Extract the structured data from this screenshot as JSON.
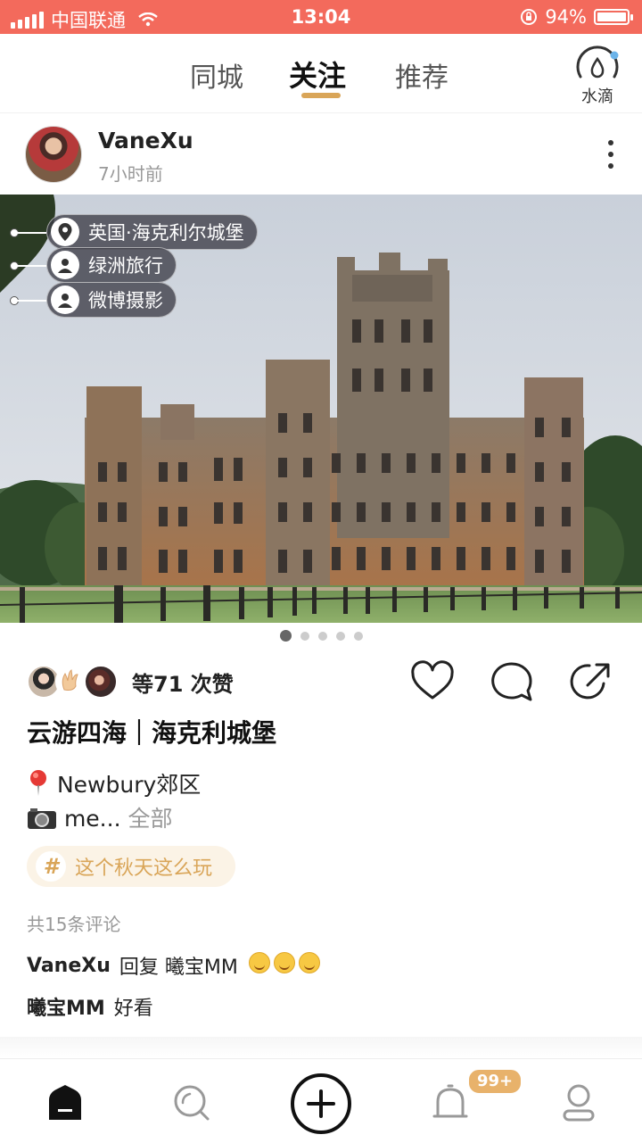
{
  "status_bar": {
    "carrier": "中国联通",
    "time": "13:04",
    "battery": "94%"
  },
  "top_nav": {
    "tabs": [
      "同城",
      "关注",
      "推荐"
    ],
    "active_tab": "关注",
    "drop_label": "水滴"
  },
  "post": {
    "username": "VaneXu",
    "time_ago": "7小时前",
    "tags": [
      "英国·海克利尔城堡",
      "绿洲旅行",
      "微博摄影"
    ],
    "carousel": {
      "total": 5,
      "current": 1
    },
    "likes_text": "等71 次赞",
    "title": "云游四海｜海克利城堡",
    "location_line": "Newbury郊区",
    "caption_preview": "me...",
    "caption_more": "全部",
    "topic": "这个秋天这么玩",
    "comment_count": "共15条评论",
    "comments": [
      {
        "user": "VaneXu",
        "text": "回复 曦宝MM",
        "emoji_count": 3
      },
      {
        "user": "曦宝MM",
        "text": "好看",
        "emoji_count": 0
      }
    ]
  },
  "bottom_nav": {
    "badge": "99+",
    "items": [
      "home-icon",
      "search-icon",
      "add-icon",
      "bell-icon",
      "profile-icon"
    ]
  },
  "colors": {
    "status_bar": "#f36a5c",
    "accent": "#d9a558",
    "badge": "#e8b26b"
  }
}
